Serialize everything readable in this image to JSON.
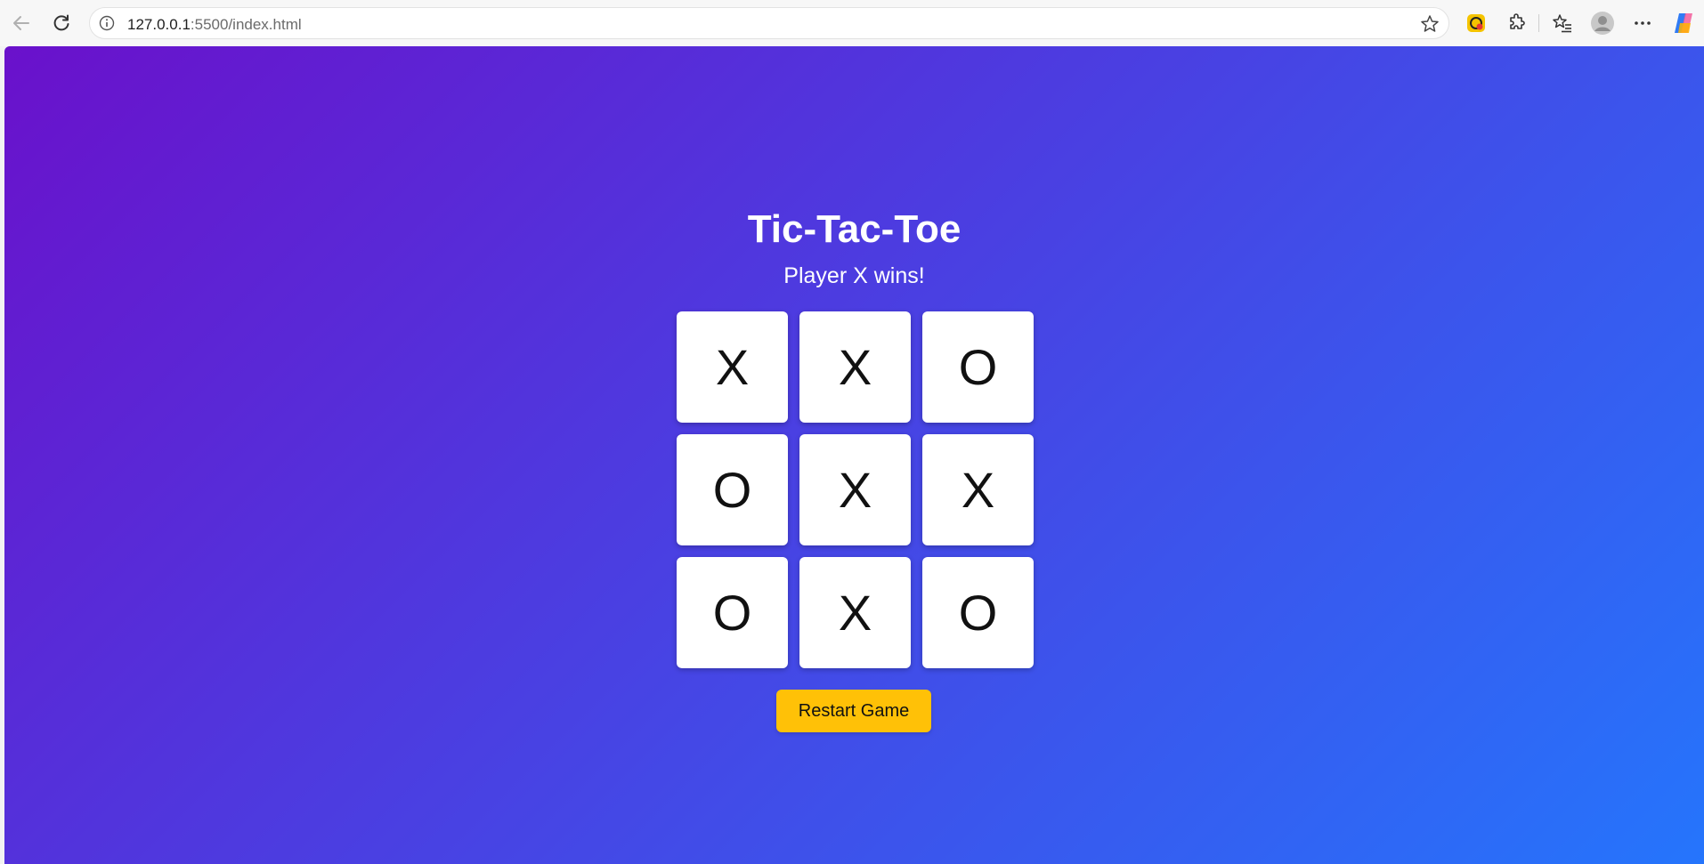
{
  "browser": {
    "url_host": "127.0.0.1",
    "url_path": ":5500/index.html",
    "icons": [
      "back-arrow-icon",
      "reload-icon",
      "info-icon",
      "star-icon",
      "extension-badge-icon",
      "puzzle-icon",
      "favorites-icon",
      "profile-icon",
      "more-icon",
      "copilot-icon"
    ]
  },
  "game": {
    "title": "Tic-Tac-Toe",
    "status": "Player X wins!",
    "board": [
      "X",
      "X",
      "O",
      "O",
      "X",
      "X",
      "O",
      "X",
      "O"
    ],
    "restart_label": "Restart Game"
  },
  "colors": {
    "gradient_start": "#6a11cb",
    "gradient_end": "#2575fc",
    "button": "#ffc107",
    "cell": "#ffffff"
  }
}
